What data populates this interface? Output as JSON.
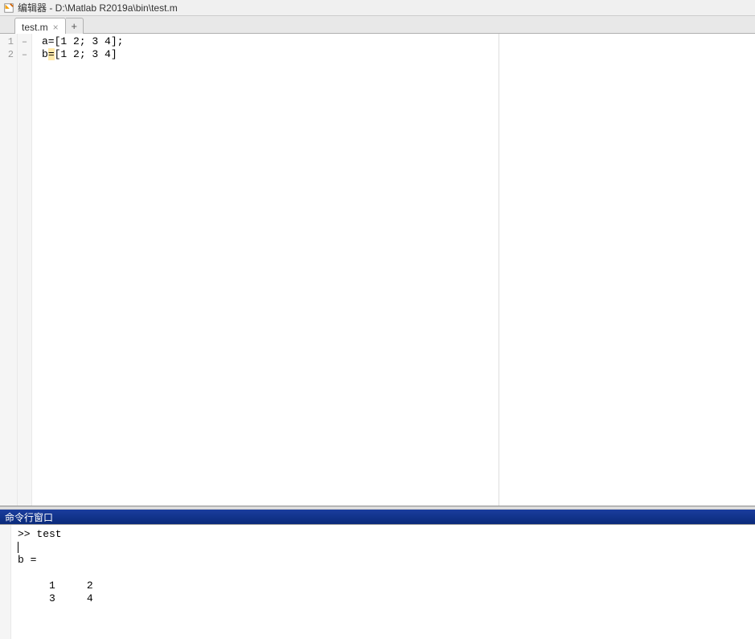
{
  "window": {
    "title": "编辑器 - D:\\Matlab R2019a\\bin\\test.m"
  },
  "tabs": {
    "active": {
      "label": "test.m"
    }
  },
  "editor": {
    "lines": [
      {
        "num": "1",
        "dash": "–",
        "code": "a=[1 2; 3 4];"
      },
      {
        "num": "2",
        "dash": "–",
        "code_prefix": "b",
        "code_eq": "=",
        "code_suffix": "[1 2; 3 4]"
      }
    ]
  },
  "commandWindow": {
    "title": "命令行窗口",
    "prompt": ">> ",
    "input": "test",
    "output_var": "b =",
    "output_rows": [
      "     1     2",
      "     3     4"
    ]
  }
}
